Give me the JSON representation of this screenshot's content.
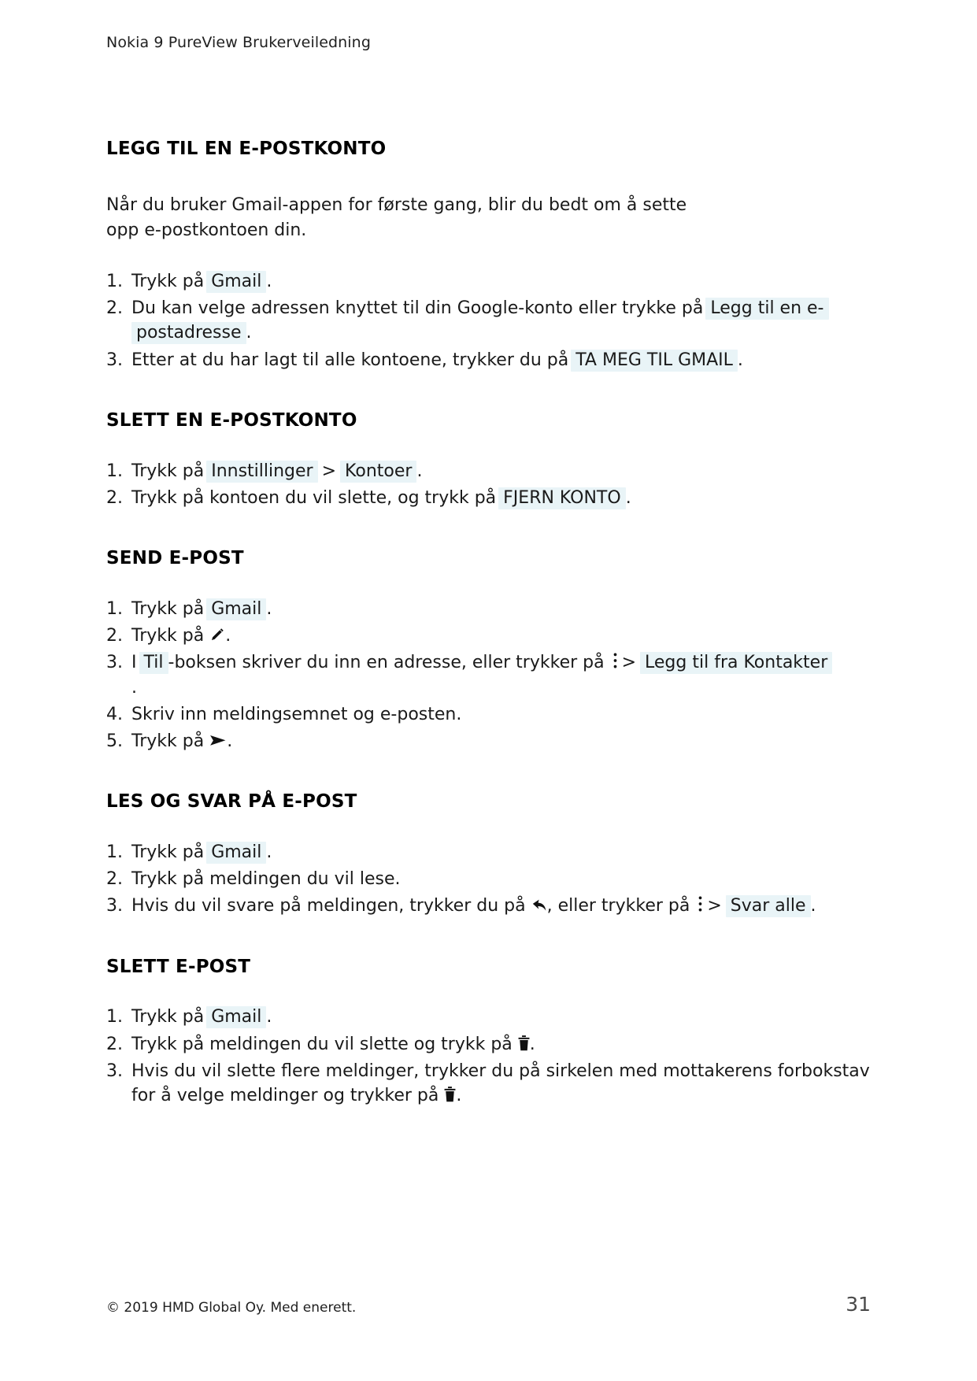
{
  "document": {
    "running_header": "Nokia 9 PureView Brukerveiledning",
    "page_number": "31",
    "copyright": "© 2019 HMD Global Oy. Med enerett.",
    "highlight_color": "#e9f4f7"
  },
  "sections": {
    "add_account": {
      "heading": "LEGG TIL EN E-POSTKONTO",
      "intro": "Når du bruker Gmail-appen for første gang, blir du bedt om å sette opp e-postkontoen din.",
      "step1": {
        "pre": "Trykk på",
        "ui": "Gmail",
        "post": "."
      },
      "step2": {
        "pre": "Du kan velge adressen knyttet til din Google-konto eller trykke på",
        "ui": "Legg til en e-postadresse",
        "post": "."
      },
      "step3": {
        "pre": "Etter at du har lagt til alle kontoene, trykker du på",
        "ui": "TA MEG TIL GMAIL",
        "post": "."
      }
    },
    "delete_account": {
      "heading": "SLETT EN E-POSTKONTO",
      "step1": {
        "pre": "Trykk på",
        "ui1": "Innstillinger",
        "sep": ">",
        "ui2": "Kontoer",
        "post": "."
      },
      "step2": {
        "pre": "Trykk på kontoen du vil slette, og trykk på",
        "ui": "FJERN KONTO",
        "post": "."
      }
    },
    "send_mail": {
      "heading": "SEND E-POST",
      "step1": {
        "pre": "Trykk på",
        "ui": "Gmail",
        "post": "."
      },
      "step2": {
        "pre": "Trykk på",
        "icon": "pencil-icon",
        "post": "."
      },
      "step3": {
        "pre": "I",
        "ui1": "Til",
        "mid": "-boksen skriver du inn en adresse, eller trykker på",
        "icon": "more-vertical-icon",
        "sep": ">",
        "ui2": "Legg til fra Kontakter",
        "post": "."
      },
      "step4": {
        "text": "Skriv inn meldingsemnet og e-posten."
      },
      "step5": {
        "pre": "Trykk på",
        "icon": "send-icon",
        "post": "."
      }
    },
    "read_reply": {
      "heading": "LES OG SVAR PÅ E-POST",
      "step1": {
        "pre": "Trykk på",
        "ui": "Gmail",
        "post": "."
      },
      "step2": {
        "text": "Trykk på meldingen du vil lese."
      },
      "step3": {
        "pre": "Hvis du vil svare på meldingen, trykker du på",
        "icon1": "reply-arrow-icon",
        "mid": ", eller trykker på",
        "icon2": "more-vertical-icon",
        "sep": ">",
        "ui": "Svar alle",
        "post": "."
      }
    },
    "delete_mail": {
      "heading": "SLETT E-POST",
      "step1": {
        "pre": "Trykk på",
        "ui": "Gmail",
        "post": "."
      },
      "step2": {
        "pre": "Trykk på meldingen du vil slette og trykk på",
        "icon": "trash-icon",
        "post": "."
      },
      "step3": {
        "pre": "Hvis du vil slette flere meldinger, trykker du på sirkelen med mottakerens forbokstav for å velge meldinger og trykker på",
        "icon": "trash-icon",
        "post": "."
      }
    }
  }
}
